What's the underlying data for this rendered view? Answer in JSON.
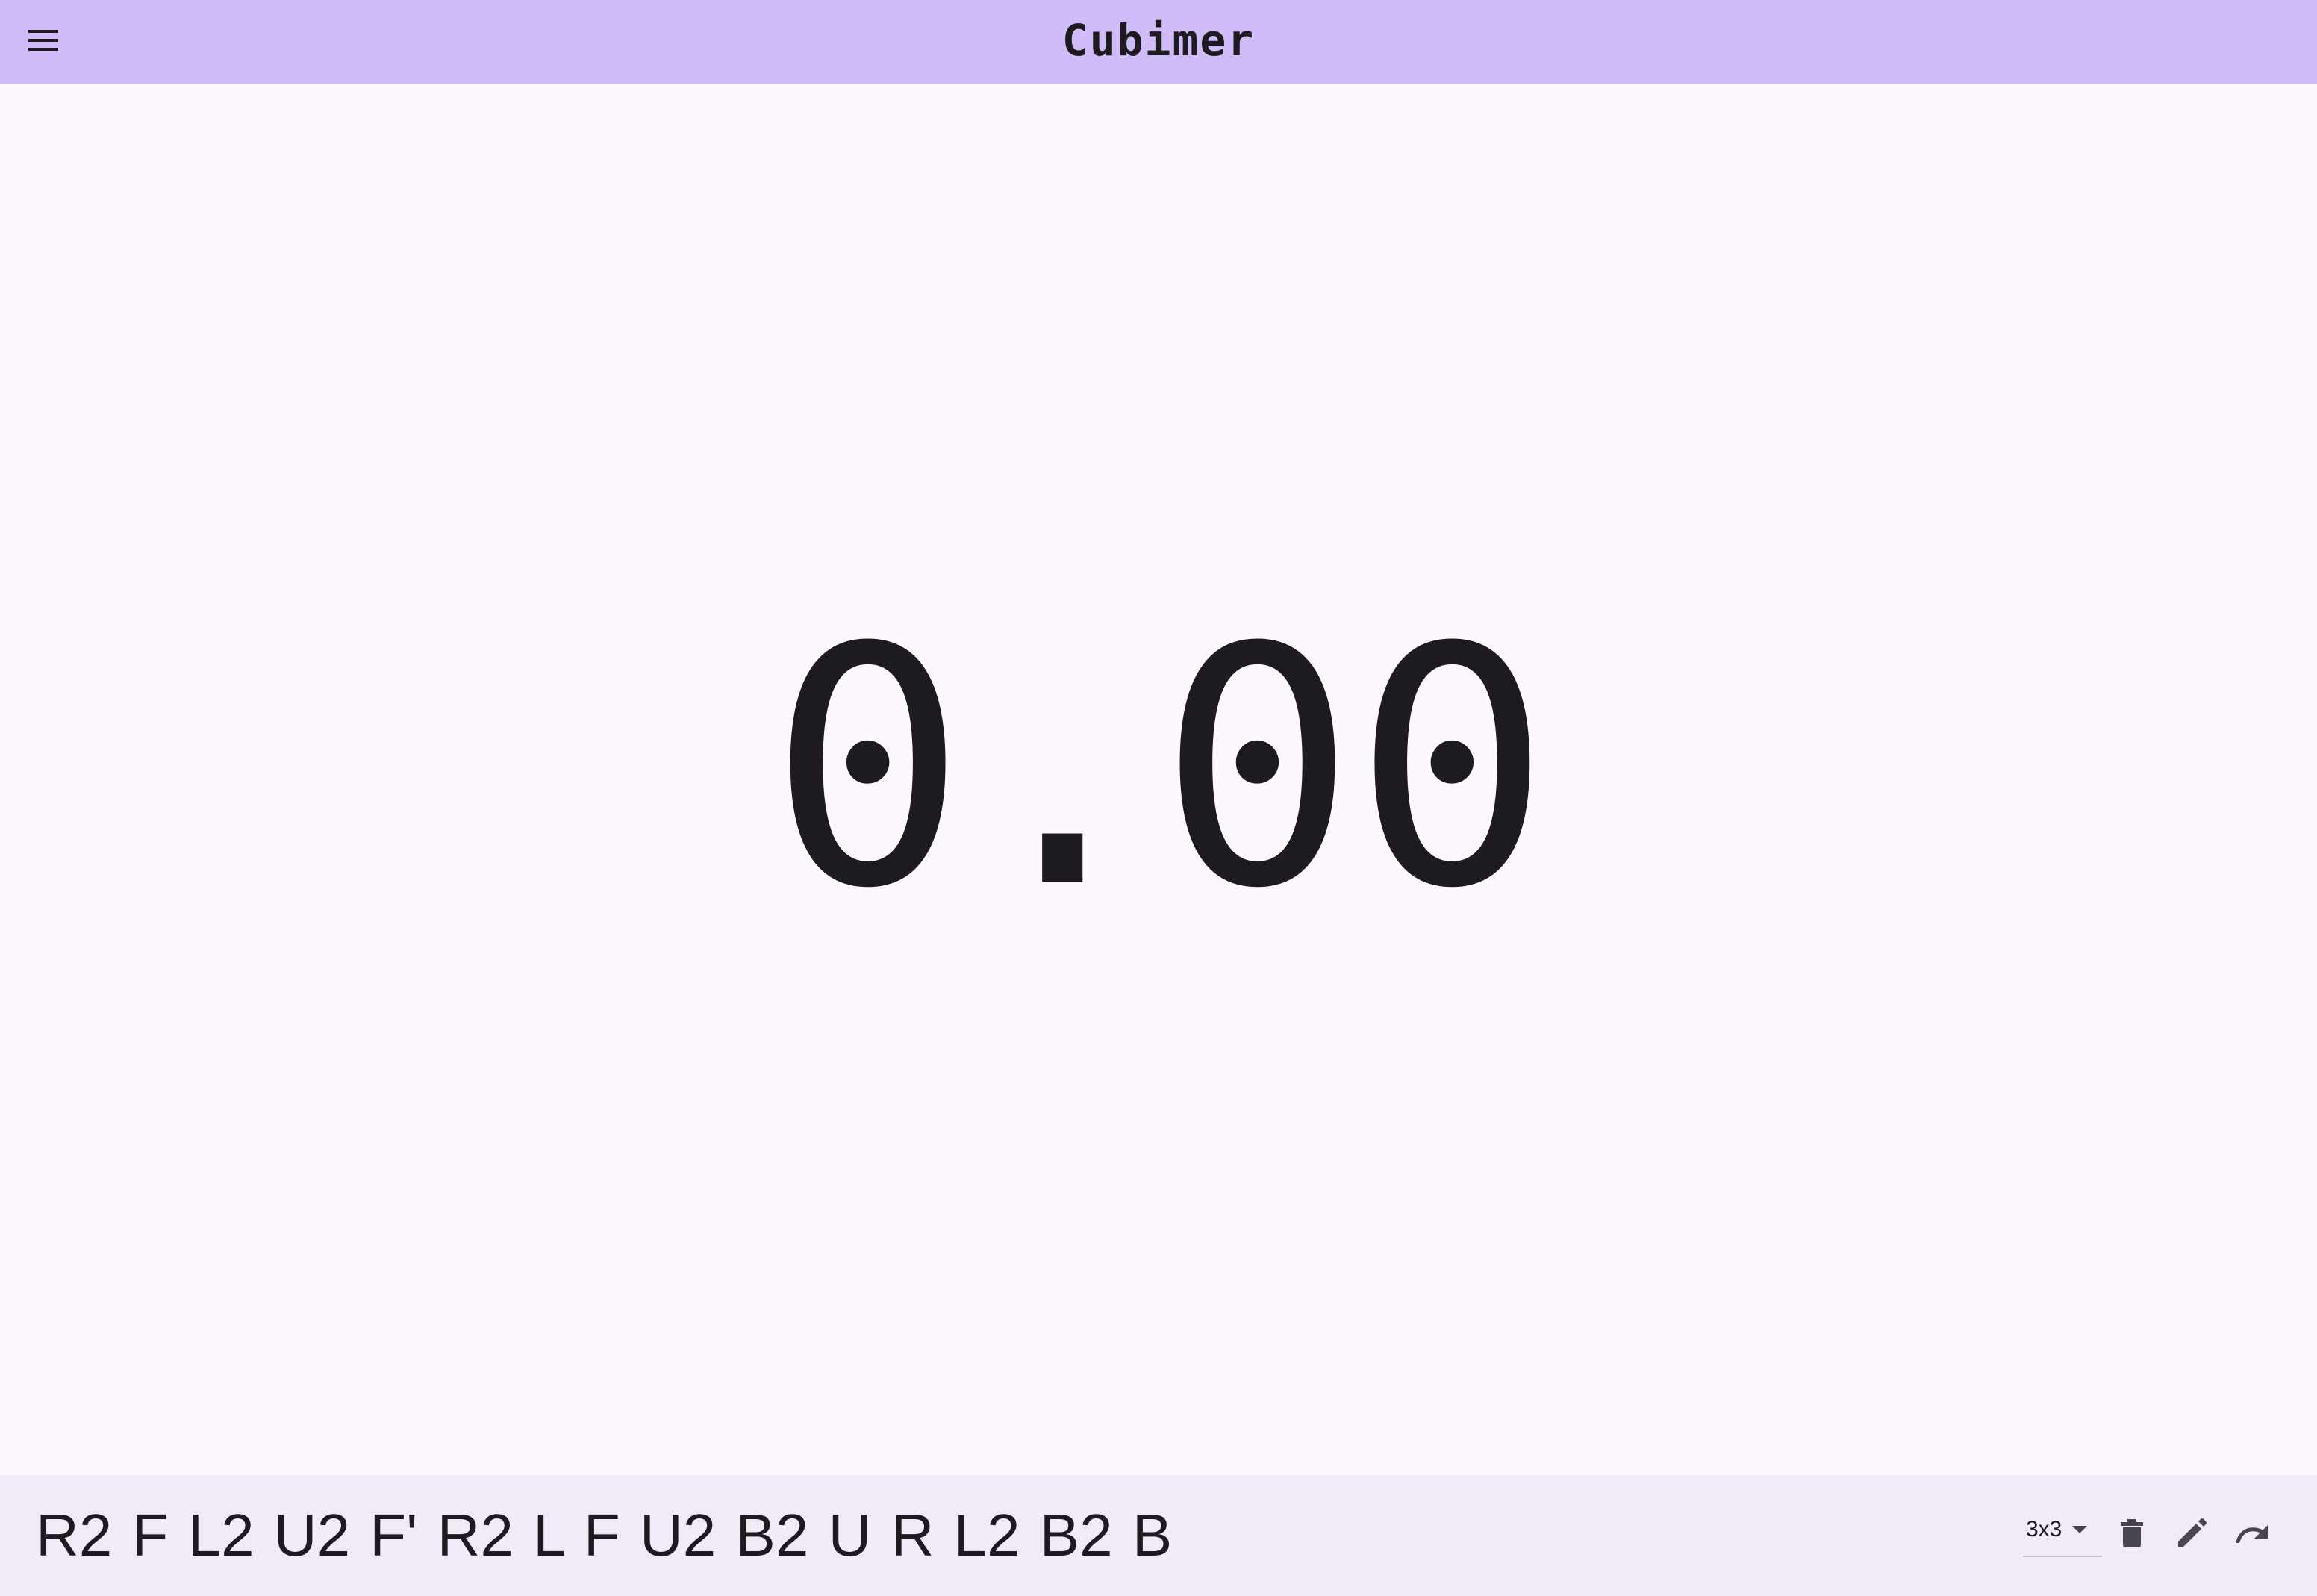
{
  "app": {
    "title": "Cubimer"
  },
  "timer": {
    "display": "0.00"
  },
  "scramble": {
    "text": "R2 F L2 U2 F' R2 L F U2 B2 U R L2 B2 B"
  },
  "puzzle_selector": {
    "selected": "3x3"
  },
  "icons": {
    "menu": "menu-icon",
    "dropdown": "caret-down-icon",
    "delete": "trash-icon",
    "edit": "pencil-icon",
    "next": "redo-icon"
  },
  "colors": {
    "top_bar": "#d0bcf9",
    "background": "#fdf8fd",
    "bottom_bar": "#f0ebf7",
    "text": "#1d1b20",
    "icon": "#49454f"
  }
}
